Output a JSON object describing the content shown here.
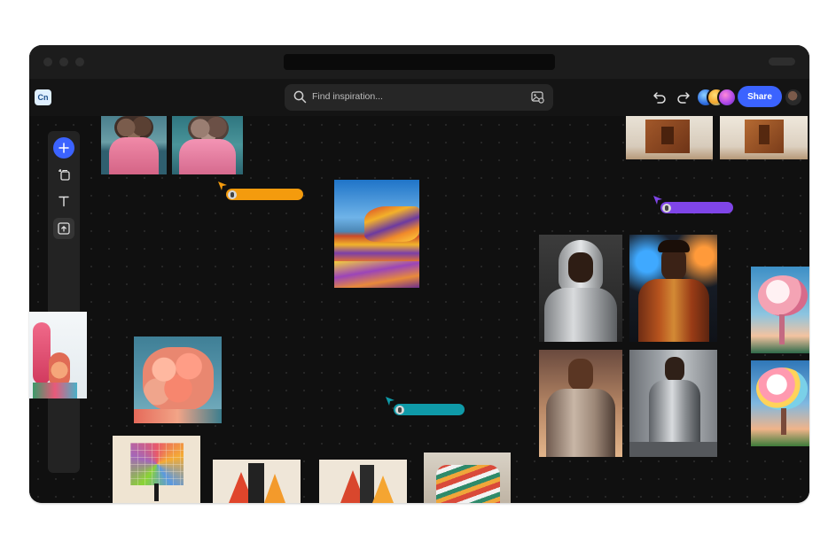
{
  "app": {
    "logo_text": "Cn"
  },
  "search": {
    "placeholder": "Find inspiration..."
  },
  "toolbar": {
    "share_label": "Share"
  },
  "colors": {
    "accent": "#3b63ff",
    "collab_orange": "#f49b0d",
    "collab_purple": "#7f45e8",
    "collab_teal": "#0f9aa8"
  },
  "icons": [
    "search-icon",
    "image-search-icon",
    "undo-icon",
    "redo-icon",
    "plus-icon",
    "copy-icon",
    "text-icon",
    "upload-icon",
    "cursor-icon"
  ],
  "collaborators": [
    {
      "name": "",
      "color": "#f49b0d"
    },
    {
      "name": "",
      "color": "#7f45e8"
    },
    {
      "name": "",
      "color": "#0f9aa8"
    }
  ],
  "images": [
    {
      "id": "flower-head-portrait-1"
    },
    {
      "id": "flower-head-portrait-2"
    },
    {
      "id": "striped-rock-landscape"
    },
    {
      "id": "wooden-sculpture-1"
    },
    {
      "id": "wooden-sculpture-2"
    },
    {
      "id": "silver-hoodie-portrait"
    },
    {
      "id": "neon-jacket-portrait"
    },
    {
      "id": "sunset-jacket-portrait"
    },
    {
      "id": "street-coat-portrait"
    },
    {
      "id": "coral-reef-edge"
    },
    {
      "id": "pink-coral"
    },
    {
      "id": "cloud-tree-1"
    },
    {
      "id": "cloud-tree-2"
    },
    {
      "id": "pixel-tree"
    },
    {
      "id": "geometric-building-1"
    },
    {
      "id": "geometric-building-2"
    },
    {
      "id": "striped-sculpture"
    }
  ]
}
